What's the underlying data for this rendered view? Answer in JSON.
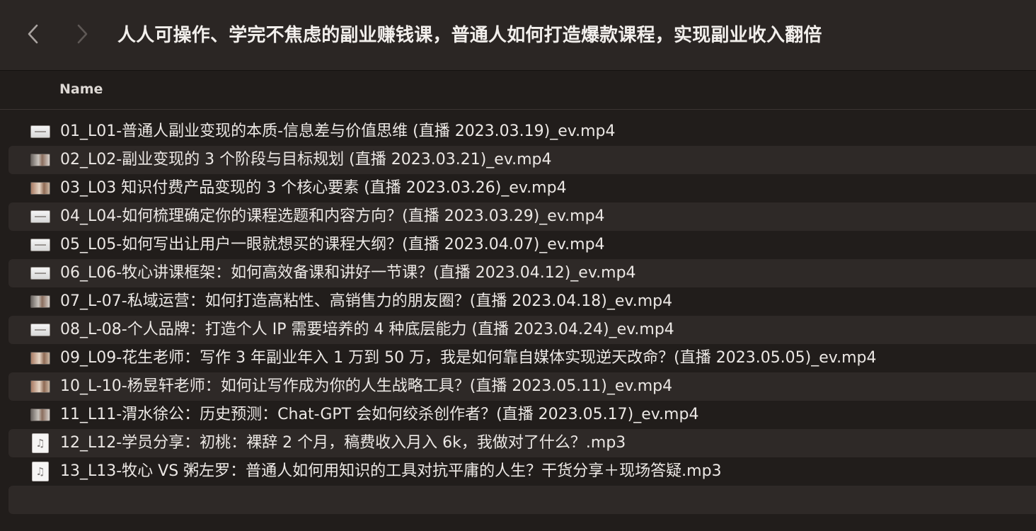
{
  "window": {
    "title": "人人可操作、学完不焦虑的副业赚钱课，普通人如何打造爆款课程，实现副业收入翻倍"
  },
  "toolbar": {
    "back_icon": "chevron-left-icon",
    "forward_icon": "chevron-right-icon"
  },
  "columns": {
    "name": "Name"
  },
  "files": [
    {
      "name": "01_L01-普通人副业变现的本质-信息差与价值思维 (直播 2023.03.19)_ev.mp4",
      "icon": "video-thumbnail-icon"
    },
    {
      "name": "02_L02-副业变现的 3 个阶段与目标规划 (直播 2023.03.21)_ev.mp4",
      "icon": "video-thumbnail-icon"
    },
    {
      "name": "03_L03 知识付费产品变现的 3 个核心要素 (直播 2023.03.26)_ev.mp4",
      "icon": "video-thumbnail-icon"
    },
    {
      "name": "04_L04-如何梳理确定你的课程选题和内容方向？(直播 2023.03.29)_ev.mp4",
      "icon": "video-thumbnail-icon"
    },
    {
      "name": "05_L05-如何写出让用户一眼就想买的课程大纲？(直播 2023.04.07)_ev.mp4",
      "icon": "video-thumbnail-icon"
    },
    {
      "name": "06_L06-牧心讲课框架：如何高效备课和讲好一节课？(直播 2023.04.12)_ev.mp4",
      "icon": "video-thumbnail-icon"
    },
    {
      "name": "07_L-07-私域运营：如何打造高粘性、高销售力的朋友圈？(直播 2023.04.18)_ev.mp4",
      "icon": "video-thumbnail-icon"
    },
    {
      "name": "08_L-08-个人品牌：打造个人 IP 需要培养的 4 种底层能力 (直播 2023.04.24)_ev.mp4",
      "icon": "video-thumbnail-icon"
    },
    {
      "name": "09_L09-花生老师：写作 3 年副业年入 1 万到 50 万，我是如何靠自媒体实现逆天改命？(直播 2023.05.05)_ev.mp4",
      "icon": "video-thumbnail-icon"
    },
    {
      "name": "10_L-10-杨昱轩老师：如何让写作成为你的人生战略工具？(直播 2023.05.11)_ev.mp4",
      "icon": "video-thumbnail-icon"
    },
    {
      "name": "11_L11-渭水徐公：历史预测：Chat-GPT 会如何绞杀创作者？(直播 2023.05.17)_ev.mp4",
      "icon": "video-thumbnail-icon"
    },
    {
      "name": "12_L12-学员分享：初桃：裸辞 2 个月，稿费收入月入 6k，我做对了什么？.mp3",
      "icon": "audio-file-icon"
    },
    {
      "name": "13_L13-牧心 VS 粥左罗：普通人如何用知识的工具对抗平庸的人生？干货分享＋现场答疑.mp3",
      "icon": "audio-file-icon"
    }
  ],
  "colors": {
    "background": "#211d1b",
    "toolbar": "#2b2624",
    "row_alt": "#2e2927",
    "text": "#ece8e5"
  }
}
